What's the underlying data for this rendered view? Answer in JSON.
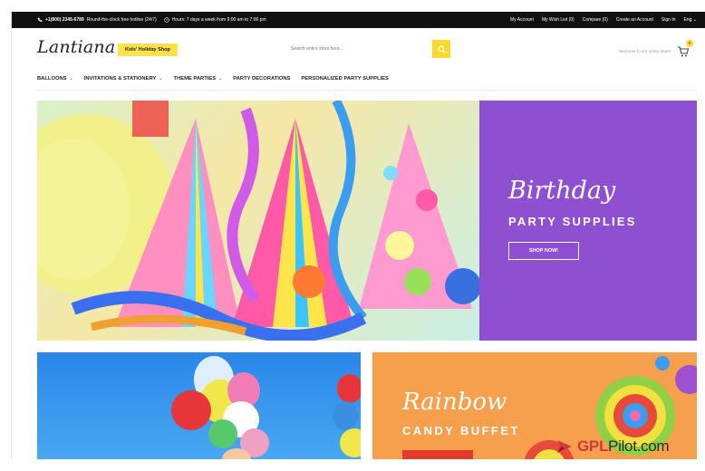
{
  "topbar": {
    "phone": "+1(800) 2345-6789",
    "hotline": "Round-the-clock free hotline (24/7)",
    "hours": "Hours: 7 days a week from 9:00 am to 7:00 pm",
    "links": [
      "My Account",
      "My Wish List (0)",
      "Compare (0)",
      "Create an Account",
      "Sign In",
      "Eng"
    ]
  },
  "header": {
    "logo": "Lantiana",
    "tagline": "Kids' Holiday Shop",
    "search_placeholder": "Search entire store here...",
    "welcome": "Welcome to our online store!",
    "cart_count": "0"
  },
  "nav": {
    "items": [
      {
        "label": "BALLOONS",
        "dropdown": true
      },
      {
        "label": "INVITATIONS & STATIONERY",
        "dropdown": true
      },
      {
        "label": "THEME PARTIES",
        "dropdown": true
      },
      {
        "label": "PARTY DECORATIONS",
        "dropdown": false
      },
      {
        "label": "PERSONALIZED PARTY SUPPLIES",
        "dropdown": false
      }
    ]
  },
  "hero": {
    "script": "Birthday",
    "subtitle": "PARTY SUPPLIES",
    "button": "SHOP NOW!"
  },
  "card2": {
    "script": "Rainbow",
    "subtitle": "CANDY BUFFET"
  },
  "watermark": {
    "brand_a": "GPL",
    "brand_b": "Pilot",
    "brand_c": ".com"
  },
  "colors": {
    "accent": "#ffd92e",
    "hero_panel": "#8e4fd0",
    "card2_bg": "#f6a04e",
    "topbar": "#111111"
  }
}
